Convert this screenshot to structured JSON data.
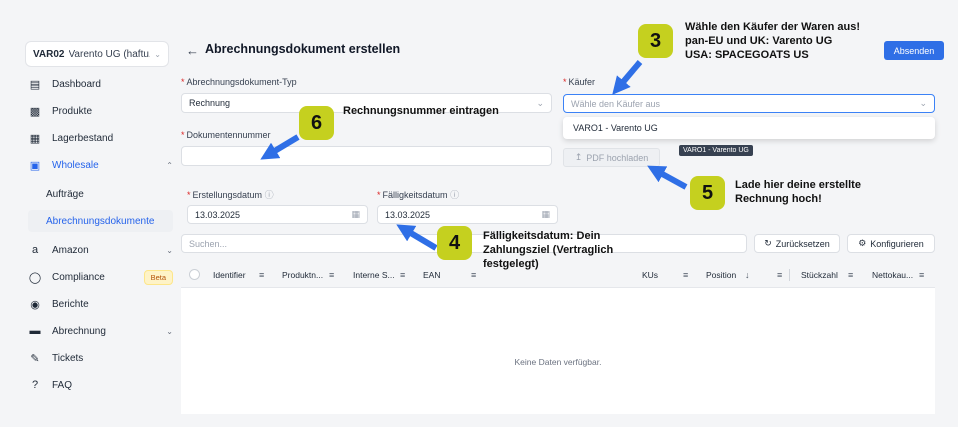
{
  "sidebar": {
    "org_code": "VAR02",
    "org_name": "Varento UG (haftu...",
    "items": [
      {
        "label": "Dashboard",
        "icon": "dashboard-icon"
      },
      {
        "label": "Produkte",
        "icon": "box-icon"
      },
      {
        "label": "Lagerbestand",
        "icon": "inventory-icon"
      },
      {
        "label": "Wholesale",
        "icon": "store-icon"
      },
      {
        "label": "Aufträge"
      },
      {
        "label": "Abrechnungsdokumente"
      },
      {
        "label": "Amazon",
        "icon": "amazon-icon"
      },
      {
        "label": "Compliance",
        "icon": "shield-icon",
        "badge": "Beta"
      },
      {
        "label": "Berichte",
        "icon": "reports-icon"
      },
      {
        "label": "Abrechnung",
        "icon": "billing-icon"
      },
      {
        "label": "Tickets",
        "icon": "ticket-icon"
      },
      {
        "label": "FAQ",
        "icon": "question-icon"
      }
    ]
  },
  "header": {
    "title": "Abrechnungsdokument erstellen",
    "submit_label": "Absenden"
  },
  "form": {
    "doc_type_label": "Abrechnungsdokument-Typ",
    "doc_type_value": "Rechnung",
    "doc_number_label": "Dokumentennummer",
    "doc_number_value": "",
    "buyer_label": "Käufer",
    "buyer_placeholder": "Wähle den Käufer aus",
    "buyer_option": "VARO1 - Varento UG",
    "buyer_tooltip": "VARO1 - Varento UG",
    "upload_label": "PDF hochladen",
    "created_label": "Erstellungsdatum",
    "created_value": "13.03.2025",
    "due_label": "Fälligkeitsdatum",
    "due_value": "13.03.2025"
  },
  "toolbar": {
    "search_placeholder": "Suchen...",
    "reset_label": "Zurücksetzen",
    "configure_label": "Konfigurieren"
  },
  "table": {
    "columns": [
      "Identifier",
      "Produktn...",
      "Interne S...",
      "EAN",
      "KUs",
      "Position",
      "Stückzahl",
      "Nettokau..."
    ],
    "empty_text": "Keine Daten verfügbar."
  },
  "annotations": {
    "step3_num": "3",
    "step3_lines": [
      "Wähle den Käufer der Waren aus!",
      "pan-EU und UK: Varento UG",
      "USA: SPACEGOATS US"
    ],
    "step4_num": "4",
    "step4_lines": [
      "Fälligkeitsdatum: Dein",
      "Zahlungsziel (Vertraglich",
      "festgelegt)"
    ],
    "step5_num": "5",
    "step5_lines": [
      "Lade hier deine erstellte",
      "Rechnung hoch!"
    ],
    "step6_num": "6",
    "step6_text": "Rechnungsnummer eintragen"
  },
  "colors": {
    "accent": "#2f6fe6",
    "annotation_badge": "#c5d01f",
    "annotation_arrow": "#2f6fe6"
  }
}
